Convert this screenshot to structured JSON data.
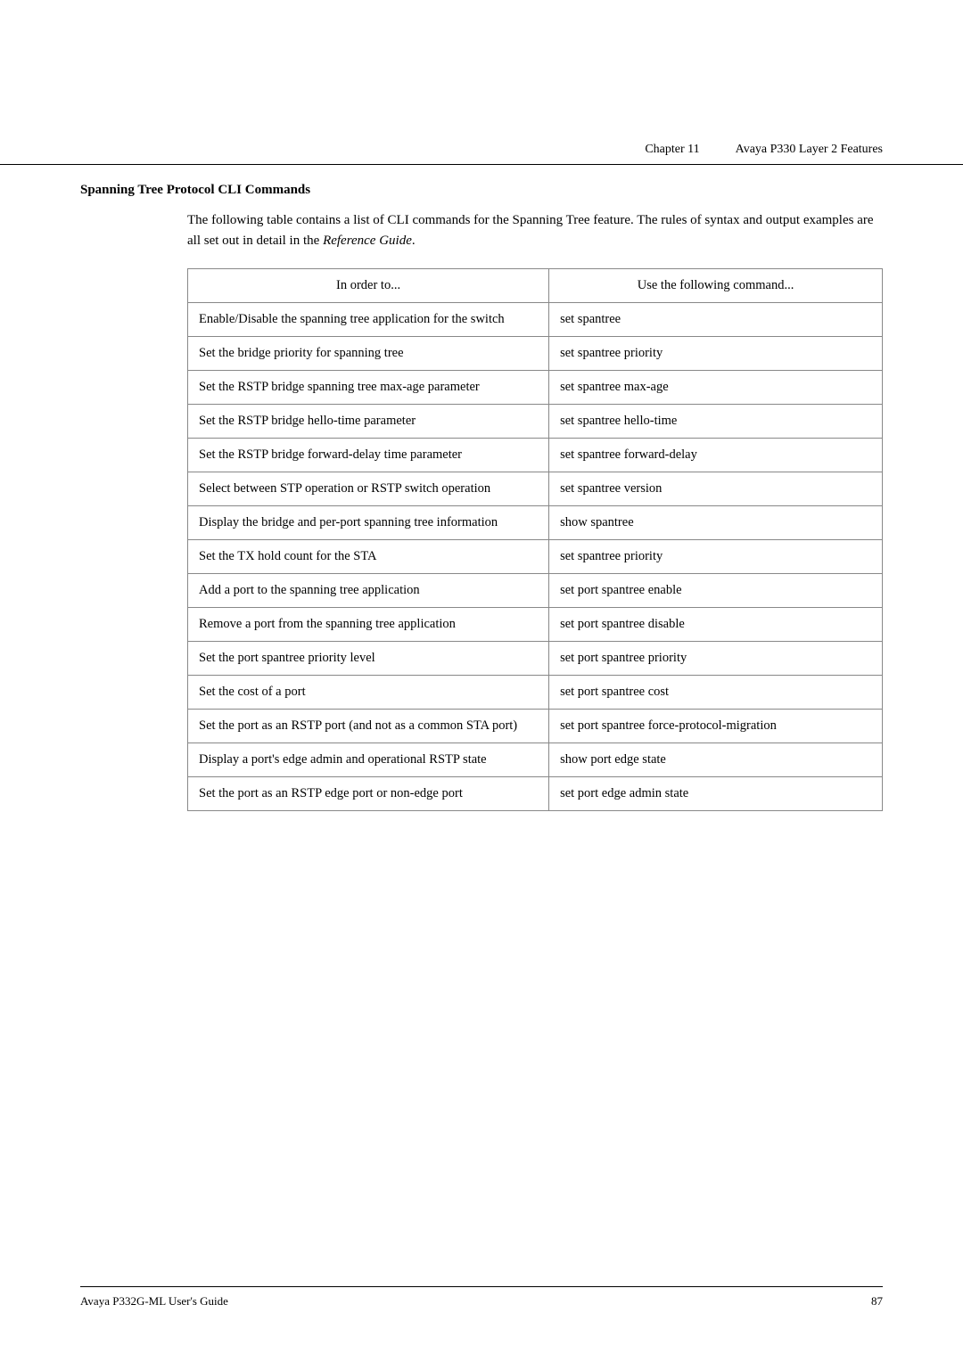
{
  "header": {
    "chapter": "Chapter 11",
    "title": "Avaya P330 Layer 2 Features"
  },
  "section": {
    "heading": "Spanning Tree Protocol CLI Commands",
    "intro": "The following table contains a list of CLI commands for the Spanning Tree feature. The rules of syntax and output examples are all set out in detail in the ",
    "intro_italic": "Reference Guide",
    "intro_end": "."
  },
  "table": {
    "col1_header": "In order to...",
    "col2_header": "Use the following command...",
    "rows": [
      {
        "description": "Enable/Disable the spanning tree application for the switch",
        "command": "set spantree"
      },
      {
        "description": "Set the bridge priority for spanning tree",
        "command": "set spantree priority"
      },
      {
        "description": "Set the RSTP bridge spanning tree max-age parameter",
        "command": "set spantree max-age"
      },
      {
        "description": "Set the RSTP bridge hello-time parameter",
        "command": "set spantree hello-time"
      },
      {
        "description": "Set the RSTP bridge forward-delay time parameter",
        "command": "set spantree forward-delay"
      },
      {
        "description": "Select between STP operation or RSTP switch operation",
        "command": "set spantree version"
      },
      {
        "description": "Display the bridge and per-port spanning tree information",
        "command": "show spantree"
      },
      {
        "description": "Set the TX hold count for the STA",
        "command": "set spantree priority"
      },
      {
        "description": "Add a port to the spanning tree application",
        "command": "set port spantree enable"
      },
      {
        "description": "Remove a port from the spanning tree application",
        "command": "set port spantree disable"
      },
      {
        "description": "Set the port spantree priority level",
        "command": "set port spantree priority"
      },
      {
        "description": "Set the cost of a port",
        "command": "set port spantree cost"
      },
      {
        "description": "Set the port as an RSTP port (and not as a common STA port)",
        "command": "set port spantree force-protocol-migration"
      },
      {
        "description": "Display a port's edge admin and operational RSTP state",
        "command": "show port edge state"
      },
      {
        "description": "Set the port as an RSTP edge port or non-edge port",
        "command": "set port edge admin state"
      }
    ]
  },
  "footer": {
    "left": "Avaya P332G-ML User's Guide",
    "right": "87"
  }
}
